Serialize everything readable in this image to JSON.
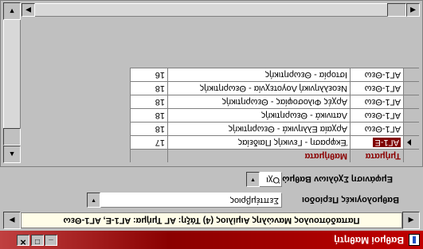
{
  "window": {
    "title": "Βαθμοί Μαθητή",
    "min_glyph": "_",
    "max_glyph": "□",
    "close_glyph": "✕"
  },
  "header": {
    "banner": "Παπαδόπουλος Μανώλης Αιμίλιος (4) Τάξη: ΑΓ Τμήμα: ΑΓ1-Ε, ΑΓ1-Θεω",
    "left_arrow": "◀",
    "right_arrow": "▶"
  },
  "form": {
    "department_label": "Βαθμολογικές Περίοδοι",
    "department_value": "Σεπτέμβριος",
    "combo_label": "Εμφάνιση Σχόλιων Βαθμών",
    "combo_value": "Όχι",
    "dropdown_arrow": "▼"
  },
  "grid": {
    "columns": [
      "Τμήματα",
      "Μαθήματα",
      ""
    ],
    "rows": [
      {
        "department": "ΑΓ1-Ε",
        "subject": "Έκφραση - Γενικής Παιδείας",
        "grade": "17"
      },
      {
        "department": "ΑΓ1-Θεω",
        "subject": "Αρχαία Ελληνικά - Θεωρητικής",
        "grade": "18"
      },
      {
        "department": "ΑΓ1-Θεω",
        "subject": "Λατινικά - Θεωρητικής",
        "grade": "18"
      },
      {
        "department": "ΑΓ1-Θεω",
        "subject": "Αρχές Φιλοσοφίας - Θεωρητικής",
        "grade": "18"
      },
      {
        "department": "ΑΓ1-Θεω",
        "subject": "Νεοελληνική Λογοτεχνία - Θεωρητικής",
        "grade": "18"
      },
      {
        "department": "ΑΓ1-Θεω",
        "subject": "Ιστορία - Θεωρητικής",
        "grade": "16"
      }
    ],
    "selected_row": 0,
    "scroll": {
      "up": "▲",
      "down": "▼",
      "left": "◀",
      "right": "▶"
    }
  },
  "colors": {
    "title_bar": "#c00000",
    "header_text": "#8b0000",
    "banner_bg": "#fffde8"
  }
}
